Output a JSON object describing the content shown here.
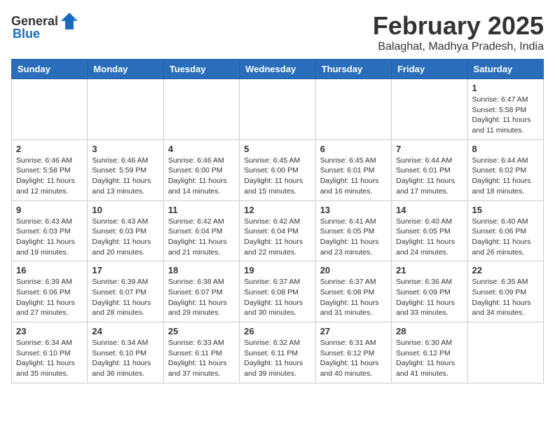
{
  "logo": {
    "general": "General",
    "blue": "Blue"
  },
  "title": "February 2025",
  "location": "Balaghat, Madhya Pradesh, India",
  "weekdays": [
    "Sunday",
    "Monday",
    "Tuesday",
    "Wednesday",
    "Thursday",
    "Friday",
    "Saturday"
  ],
  "weeks": [
    [
      {
        "day": "",
        "info": ""
      },
      {
        "day": "",
        "info": ""
      },
      {
        "day": "",
        "info": ""
      },
      {
        "day": "",
        "info": ""
      },
      {
        "day": "",
        "info": ""
      },
      {
        "day": "",
        "info": ""
      },
      {
        "day": "1",
        "info": "Sunrise: 6:47 AM\nSunset: 5:58 PM\nDaylight: 11 hours and 11 minutes."
      }
    ],
    [
      {
        "day": "2",
        "info": "Sunrise: 6:46 AM\nSunset: 5:58 PM\nDaylight: 11 hours and 12 minutes."
      },
      {
        "day": "3",
        "info": "Sunrise: 6:46 AM\nSunset: 5:59 PM\nDaylight: 11 hours and 13 minutes."
      },
      {
        "day": "4",
        "info": "Sunrise: 6:46 AM\nSunset: 6:00 PM\nDaylight: 11 hours and 14 minutes."
      },
      {
        "day": "5",
        "info": "Sunrise: 6:45 AM\nSunset: 6:00 PM\nDaylight: 11 hours and 15 minutes."
      },
      {
        "day": "6",
        "info": "Sunrise: 6:45 AM\nSunset: 6:01 PM\nDaylight: 11 hours and 16 minutes."
      },
      {
        "day": "7",
        "info": "Sunrise: 6:44 AM\nSunset: 6:01 PM\nDaylight: 11 hours and 17 minutes."
      },
      {
        "day": "8",
        "info": "Sunrise: 6:44 AM\nSunset: 6:02 PM\nDaylight: 11 hours and 18 minutes."
      }
    ],
    [
      {
        "day": "9",
        "info": "Sunrise: 6:43 AM\nSunset: 6:03 PM\nDaylight: 11 hours and 19 minutes."
      },
      {
        "day": "10",
        "info": "Sunrise: 6:43 AM\nSunset: 6:03 PM\nDaylight: 11 hours and 20 minutes."
      },
      {
        "day": "11",
        "info": "Sunrise: 6:42 AM\nSunset: 6:04 PM\nDaylight: 11 hours and 21 minutes."
      },
      {
        "day": "12",
        "info": "Sunrise: 6:42 AM\nSunset: 6:04 PM\nDaylight: 11 hours and 22 minutes."
      },
      {
        "day": "13",
        "info": "Sunrise: 6:41 AM\nSunset: 6:05 PM\nDaylight: 11 hours and 23 minutes."
      },
      {
        "day": "14",
        "info": "Sunrise: 6:40 AM\nSunset: 6:05 PM\nDaylight: 11 hours and 24 minutes."
      },
      {
        "day": "15",
        "info": "Sunrise: 6:40 AM\nSunset: 6:06 PM\nDaylight: 11 hours and 26 minutes."
      }
    ],
    [
      {
        "day": "16",
        "info": "Sunrise: 6:39 AM\nSunset: 6:06 PM\nDaylight: 11 hours and 27 minutes."
      },
      {
        "day": "17",
        "info": "Sunrise: 6:39 AM\nSunset: 6:07 PM\nDaylight: 11 hours and 28 minutes."
      },
      {
        "day": "18",
        "info": "Sunrise: 6:38 AM\nSunset: 6:07 PM\nDaylight: 11 hours and 29 minutes."
      },
      {
        "day": "19",
        "info": "Sunrise: 6:37 AM\nSunset: 6:08 PM\nDaylight: 11 hours and 30 minutes."
      },
      {
        "day": "20",
        "info": "Sunrise: 6:37 AM\nSunset: 6:08 PM\nDaylight: 11 hours and 31 minutes."
      },
      {
        "day": "21",
        "info": "Sunrise: 6:36 AM\nSunset: 6:09 PM\nDaylight: 11 hours and 33 minutes."
      },
      {
        "day": "22",
        "info": "Sunrise: 6:35 AM\nSunset: 6:09 PM\nDaylight: 11 hours and 34 minutes."
      }
    ],
    [
      {
        "day": "23",
        "info": "Sunrise: 6:34 AM\nSunset: 6:10 PM\nDaylight: 11 hours and 35 minutes."
      },
      {
        "day": "24",
        "info": "Sunrise: 6:34 AM\nSunset: 6:10 PM\nDaylight: 11 hours and 36 minutes."
      },
      {
        "day": "25",
        "info": "Sunrise: 6:33 AM\nSunset: 6:11 PM\nDaylight: 11 hours and 37 minutes."
      },
      {
        "day": "26",
        "info": "Sunrise: 6:32 AM\nSunset: 6:11 PM\nDaylight: 11 hours and 39 minutes."
      },
      {
        "day": "27",
        "info": "Sunrise: 6:31 AM\nSunset: 6:12 PM\nDaylight: 11 hours and 40 minutes."
      },
      {
        "day": "28",
        "info": "Sunrise: 6:30 AM\nSunset: 6:12 PM\nDaylight: 11 hours and 41 minutes."
      },
      {
        "day": "",
        "info": ""
      }
    ]
  ]
}
